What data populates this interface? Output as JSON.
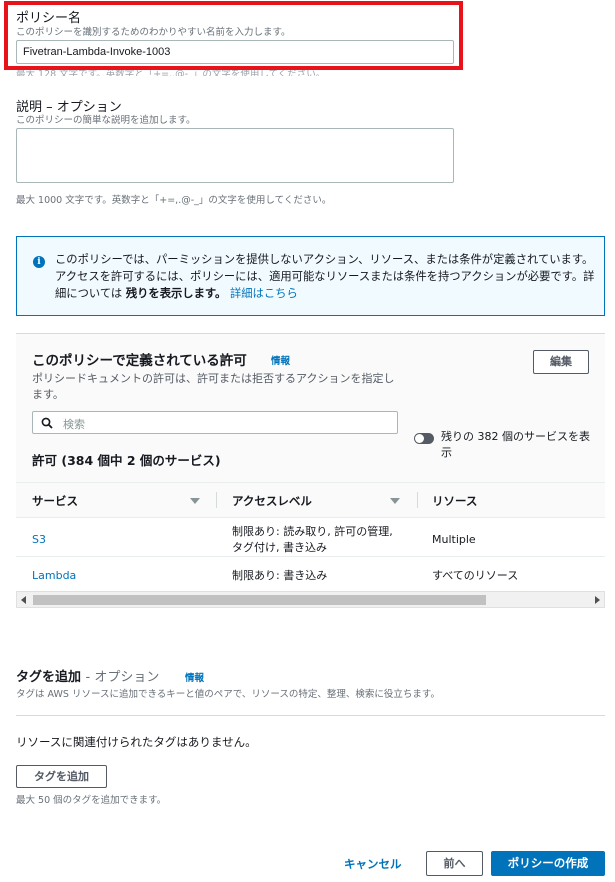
{
  "policy_name": {
    "label": "ポリシー名",
    "hint": "このポリシーを識別するためのわかりやすい名前を入力します。",
    "value": "Fivetran-Lambda-Invoke-1003",
    "constraint_hint": "最大 128 文字です。英数字と「+=,.@-_」の文字を使用してください。"
  },
  "description": {
    "label": "説明 – オプション",
    "hint": "このポリシーの簡単な説明を追加します。",
    "value": "",
    "constraint_hint": "最大 1000 文字です。英数字と「+=,.@-_」の文字を使用してください。"
  },
  "alert": {
    "icon": "info-icon",
    "text": "このポリシーでは、パーミッションを提供しないアクション、リソース、または条件が定義されています。アクセスを許可するには、ポリシーには、適用可能なリソースまたは条件を持つアクションが必要です。詳細については",
    "bold": "残りを表示します。",
    "link": "詳細はこちら"
  },
  "permissions": {
    "title": "このポリシーで定義されている許可",
    "info": "情報",
    "description": "ポリシードキュメントの許可は、許可または拒否するアクションを指定します。",
    "edit_button": "編集",
    "search_placeholder": "検索",
    "toggle_label": "残りの 382 個のサービスを表示",
    "count_label": "許可 (384 個中 2 個のサービス)",
    "columns": [
      "サービス",
      "アクセスレベル",
      "リソース"
    ],
    "rows": [
      {
        "service": "S3",
        "access": "制限あり: 読み取り, 許可の管理, タグ付け, 書き込み",
        "resource": "Multiple"
      },
      {
        "service": "Lambda",
        "access": "制限あり: 書き込み",
        "resource": "すべてのリソース"
      }
    ]
  },
  "tags": {
    "title": "タグを追加",
    "optional": "- オプション",
    "info": "情報",
    "hint": "タグは AWS リソースに追加できるキーと値のペアで、リソースの特定、整理、検索に役立ちます。",
    "empty": "リソースに関連付けられたタグはありません。",
    "add_button": "タグを追加",
    "limit": "最大 50 個のタグを追加できます。"
  },
  "footer": {
    "cancel": "キャンセル",
    "previous": "前へ",
    "create": "ポリシーの作成"
  },
  "colors": {
    "accent": "#0073bb",
    "highlight": "#e8121b"
  }
}
